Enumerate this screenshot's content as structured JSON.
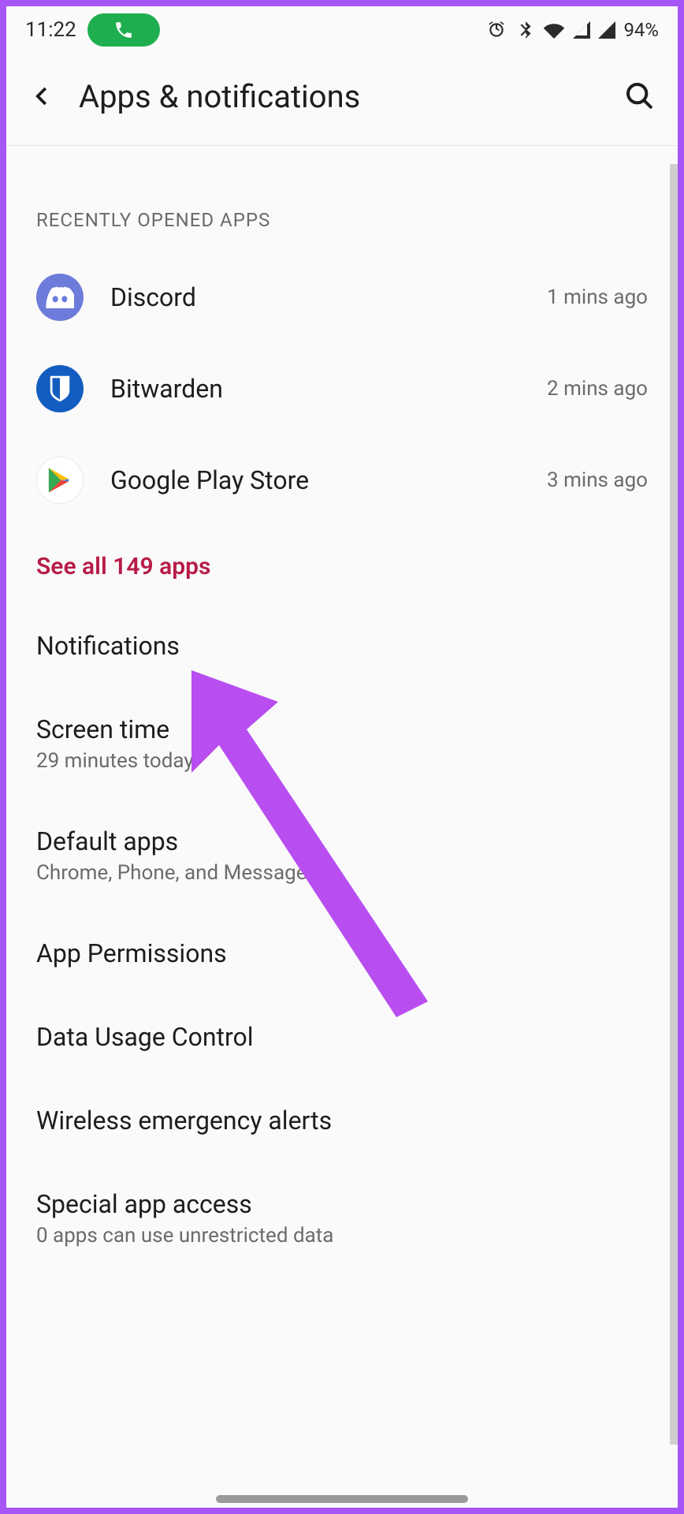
{
  "status": {
    "time": "11:22",
    "battery": "94%"
  },
  "header": {
    "title": "Apps & notifications"
  },
  "recent": {
    "label": "RECENTLY OPENED APPS",
    "apps": [
      {
        "name": "Discord",
        "time": "1 mins ago",
        "icon": "discord"
      },
      {
        "name": "Bitwarden",
        "time": "2 mins ago",
        "icon": "bitwarden"
      },
      {
        "name": "Google Play Store",
        "time": "3 mins ago",
        "icon": "play"
      }
    ],
    "see_all": "See all 149 apps"
  },
  "settings": [
    {
      "title": "Notifications",
      "sub": ""
    },
    {
      "title": "Screen time",
      "sub": "29 minutes today"
    },
    {
      "title": "Default apps",
      "sub": "Chrome, Phone, and Messages"
    },
    {
      "title": "App Permissions",
      "sub": ""
    },
    {
      "title": "Data Usage Control",
      "sub": ""
    },
    {
      "title": "Wireless emergency alerts",
      "sub": ""
    },
    {
      "title": "Special app access",
      "sub": "0 apps can use unrestricted data"
    }
  ],
  "annotation": {
    "color": "#b84ef0"
  }
}
